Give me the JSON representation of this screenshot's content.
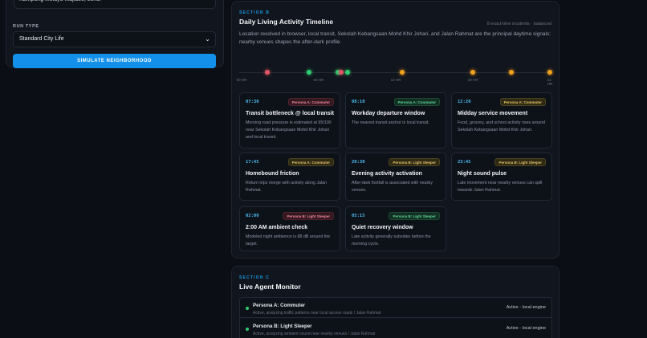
{
  "form": {
    "location_value": "Kampung Melayu Majidee, Johor",
    "run_type_label": "RUN TYPE",
    "run_type_value": "Standard City Life",
    "simulate_label": "SIMULATE NEIGHBORHOOD"
  },
  "timeline_section": {
    "eyebrow": "SECTION B",
    "title": "Daily Living Activity Timeline",
    "incidents": "8 exact-time incidents · balanced",
    "description": "Location resolved in browser, local transit, Sekolah Kebangsaan Mohd Khir Johari, and Jalan Rahmat are the principal daytime signals; nearby venues shapes the after-dark profile.",
    "ticks": [
      "00 HR",
      "06 HR",
      "12 HR",
      "18 HR",
      "24 HR"
    ],
    "markers": [
      {
        "hour": 2.0,
        "color": "#e05565"
      },
      {
        "hour": 5.25,
        "color": "#2ecc71"
      },
      {
        "hour": 7.5,
        "color": "#2ecc71"
      },
      {
        "hour": 7.75,
        "color": "#e05565"
      },
      {
        "hour": 8.25,
        "color": "#2ecc71"
      },
      {
        "hour": 12.5,
        "color": "#f0a020"
      },
      {
        "hour": 18.0,
        "color": "#f0a020"
      },
      {
        "hour": 21.0,
        "color": "#f0a020"
      },
      {
        "hour": 24.0,
        "color": "#f0a020"
      }
    ],
    "events": [
      {
        "time": "07:30",
        "badge": "Persona A: Commuter",
        "badge_style": "a-red",
        "title": "Transit bottleneck @ local transit",
        "body": "Morning road pressure is estimated at 95/100 near Sekolah Kebangsaan Mohd Khir Johari and local transit."
      },
      {
        "time": "08:10",
        "badge": "Persona A: Commuter",
        "badge_style": "a-green",
        "title": "Workday departure window",
        "body": "The nearest transit anchor is local transit."
      },
      {
        "time": "12:20",
        "badge": "Persona A: Commuter",
        "badge_style": "a",
        "title": "Midday service movement",
        "body": "Food, grocery, and school activity rises around Sekolah Kebangsaan Mohd Khir Johari."
      },
      {
        "time": "17:45",
        "badge": "Persona A: Commuter",
        "badge_style": "a",
        "title": "Homebound friction",
        "body": "Return trips merge with activity along Jalan Rahmat."
      },
      {
        "time": "20:30",
        "badge": "Persona B: Light Sleeper",
        "badge_style": "a",
        "title": "Evening activity activation",
        "body": "After-dark footfall is associated with nearby venues."
      },
      {
        "time": "23:45",
        "badge": "Persona B: Light Sleeper",
        "badge_style": "a",
        "title": "Night sound pulse",
        "body": "Late movement near nearby venues can spill towards Jalan Rahmat."
      },
      {
        "time": "02:00",
        "badge": "Persona B: Light Sleeper",
        "badge_style": "a-red",
        "title": "2:00 AM ambient check",
        "body": "Modeled night ambience is 88 dB around the target."
      },
      {
        "time": "05:15",
        "badge": "Persona B: Light Sleeper",
        "badge_style": "a-green",
        "title": "Quiet recovery window",
        "body": "Late activity generally subsides before the morning cycle."
      }
    ]
  },
  "monitor_section": {
    "eyebrow": "SECTION C",
    "title": "Live Agent Monitor",
    "agents": [
      {
        "name": "Persona A: Commuter",
        "activity": "Active, analyzing traffic patterns near local access roads / Jalan Rahmat",
        "status": "Active - local engine"
      },
      {
        "name": "Persona B: Light Sleeper",
        "activity": "Active, analyzing ambient sound near nearby venues / Jalan Rahmat",
        "status": "Active - local engine"
      }
    ]
  },
  "colors": {
    "accent": "#1391ea",
    "active_dot": "#2ecc71"
  }
}
